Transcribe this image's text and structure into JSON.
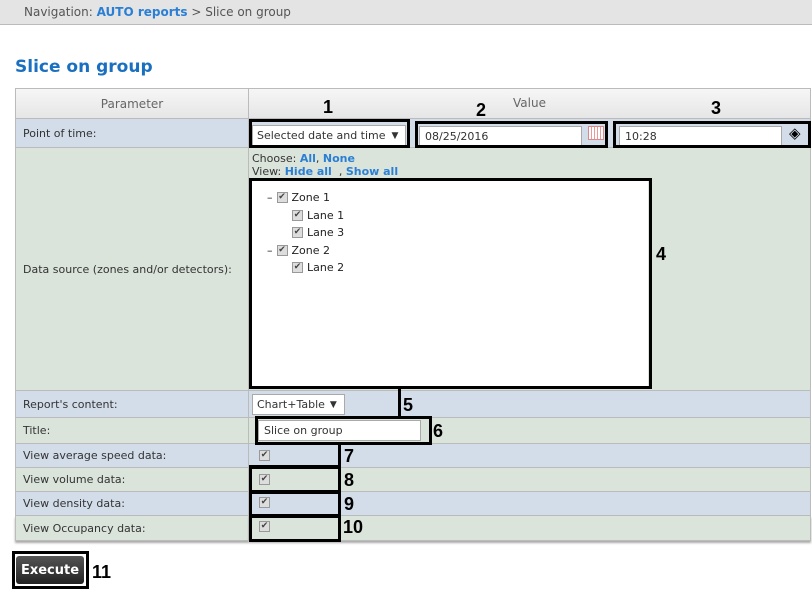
{
  "nav": {
    "prefix": "Navigation:",
    "link": "AUTO reports",
    "separator": ">",
    "current": "Slice on group"
  },
  "page_title": "Slice on group",
  "table": {
    "header_param": "Parameter",
    "header_value": "Value"
  },
  "rows": {
    "point_of_time": "Point of time:",
    "data_source": "Data source (zones and/or detectors):",
    "report_content": "Report's content:",
    "title": "Title:",
    "avg_speed": "View average speed data:",
    "volume": "View volume data:",
    "density": "View density data:",
    "occupancy": "View Occupancy data:"
  },
  "fields": {
    "time_mode": "Selected date and time",
    "date": "08/25/2016",
    "time": "10:28",
    "report_content": "Chart+Table",
    "title": "Slice on group"
  },
  "choose": {
    "label": "Choose:",
    "all": "All",
    "comma": ",",
    "none": "None"
  },
  "view": {
    "label": "View:",
    "hide_all": "Hide all",
    "comma": ",",
    "show_all": "Show all"
  },
  "tree": {
    "zone1": "Zone 1",
    "lane1": "Lane 1",
    "lane3": "Lane 3",
    "zone2": "Zone 2",
    "lane2": "Lane 2",
    "collapse": "–"
  },
  "checks": {
    "avg_speed": true,
    "volume": true,
    "density": true,
    "occupancy": true
  },
  "execute": "Execute",
  "callouts": [
    "1",
    "2",
    "3",
    "4",
    "5",
    "6",
    "7",
    "8",
    "9",
    "10",
    "11"
  ]
}
